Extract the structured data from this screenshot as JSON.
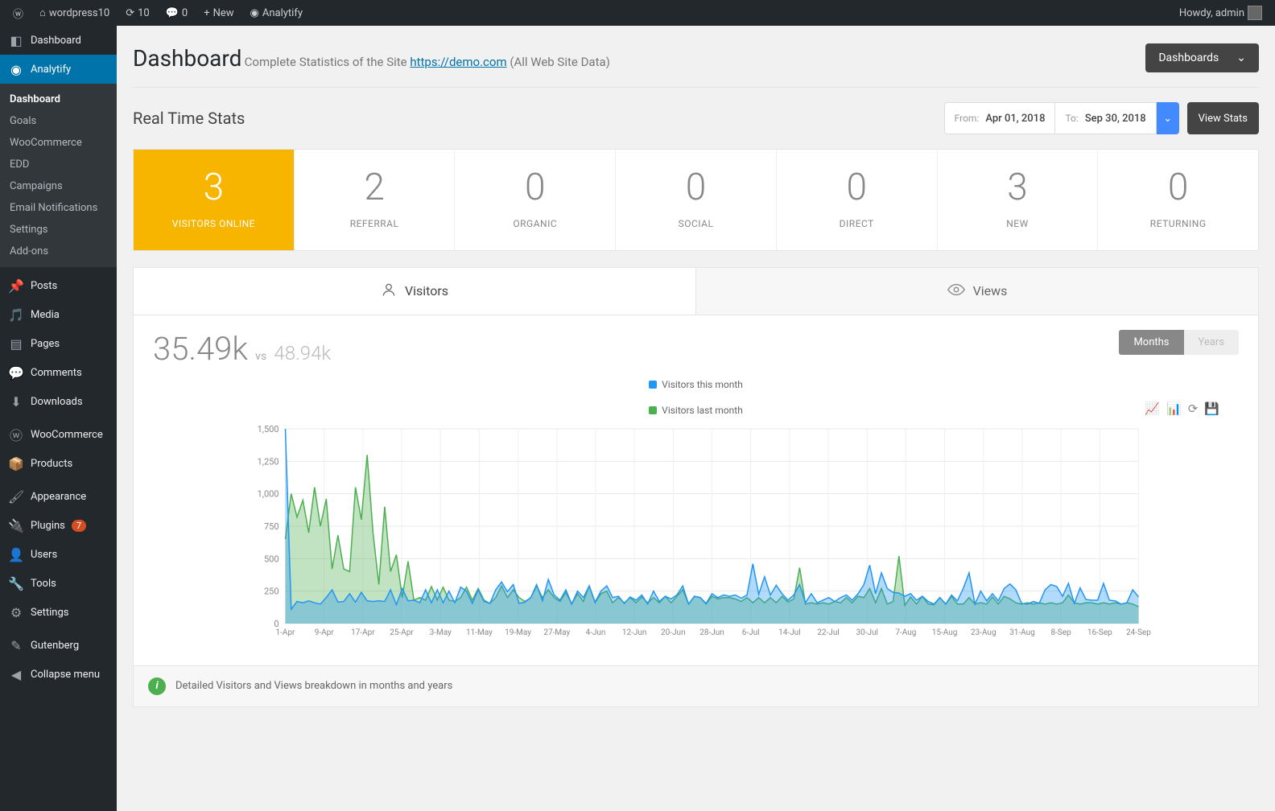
{
  "topbar": {
    "site_name": "wordpress10",
    "update_count": "10",
    "comment_count": "0",
    "new_label": "New",
    "analytify_label": "Analytify",
    "howdy": "Howdy, admin"
  },
  "sidebar": {
    "items": [
      {
        "label": "Dashboard",
        "icon": "dashboard"
      },
      {
        "label": "Analytify",
        "icon": "chart",
        "active": true
      },
      {
        "label": "Posts",
        "icon": "pin"
      },
      {
        "label": "Media",
        "icon": "media"
      },
      {
        "label": "Pages",
        "icon": "pages"
      },
      {
        "label": "Comments",
        "icon": "comment"
      },
      {
        "label": "Downloads",
        "icon": "download"
      },
      {
        "label": "WooCommerce",
        "icon": "woo"
      },
      {
        "label": "Products",
        "icon": "box"
      },
      {
        "label": "Appearance",
        "icon": "brush"
      },
      {
        "label": "Plugins",
        "icon": "plug",
        "badge": "7"
      },
      {
        "label": "Users",
        "icon": "user"
      },
      {
        "label": "Tools",
        "icon": "wrench"
      },
      {
        "label": "Settings",
        "icon": "sliders"
      },
      {
        "label": "Gutenberg",
        "icon": "edit"
      },
      {
        "label": "Collapse menu",
        "icon": "collapse"
      }
    ],
    "sub": [
      "Dashboard",
      "Goals",
      "WooCommerce",
      "EDD",
      "Campaigns",
      "Email Notifications",
      "Settings",
      "Add-ons"
    ]
  },
  "header": {
    "title": "Dashboard",
    "subtitle_pre": "Complete Statistics of the Site ",
    "site_url": "https://demo.com",
    "subtitle_post": " (All Web Site Data)",
    "dashboards_btn": "Dashboards"
  },
  "realtime": {
    "title": "Real Time Stats",
    "from_label": "From:",
    "from": "Apr 01, 2018",
    "to_label": "To:",
    "to": "Sep 30, 2018",
    "view_btn": "View Stats"
  },
  "stats": [
    {
      "num": "3",
      "label": "VISITORS ONLINE",
      "highlight": true
    },
    {
      "num": "2",
      "label": "REFERRAL"
    },
    {
      "num": "0",
      "label": "ORGANIC"
    },
    {
      "num": "0",
      "label": "SOCIAL"
    },
    {
      "num": "0",
      "label": "DIRECT"
    },
    {
      "num": "3",
      "label": "NEW"
    },
    {
      "num": "0",
      "label": "RETURNING"
    }
  ],
  "tabs": {
    "visitors": "Visitors",
    "views": "Views"
  },
  "metric": {
    "main": "35.49k",
    "vs": "vs",
    "sub": "48.94k"
  },
  "toggle": {
    "months": "Months",
    "years": "Years"
  },
  "legend": {
    "this": "Visitors this month",
    "last": "Visitors last month"
  },
  "footer": "Detailed Visitors and Views breakdown in months and years",
  "chart_data": {
    "type": "line",
    "xlabel": "",
    "ylabel": "",
    "ylim": [
      0,
      1500
    ],
    "yticks": [
      0,
      250,
      500,
      750,
      1000,
      1250,
      1500
    ],
    "categories": [
      "1-Apr",
      "9-Apr",
      "17-Apr",
      "25-Apr",
      "3-May",
      "11-May",
      "19-May",
      "27-May",
      "4-Jun",
      "12-Jun",
      "20-Jun",
      "28-Jun",
      "6-Jul",
      "14-Jul",
      "22-Jul",
      "30-Jul",
      "7-Aug",
      "15-Aug",
      "23-Aug",
      "31-Aug",
      "8-Sep",
      "16-Sep",
      "24-Sep"
    ],
    "series": [
      {
        "name": "Visitors last month",
        "color": "#4caf50",
        "values": [
          650,
          1000,
          820,
          950,
          700,
          1050,
          750,
          960,
          420,
          680,
          420,
          400,
          1050,
          800,
          1300,
          700,
          300,
          900,
          400,
          530,
          200,
          480,
          180,
          200,
          180,
          285,
          180,
          280,
          180,
          170,
          200,
          280,
          180,
          270,
          180,
          155,
          200,
          290,
          200,
          260,
          200,
          170,
          200,
          290,
          200,
          260,
          200,
          170,
          240,
          150,
          230,
          170,
          290,
          160,
          230,
          250,
          160,
          200,
          160,
          200,
          160,
          205,
          160,
          200,
          160,
          210,
          160,
          210,
          260,
          150,
          210,
          200,
          150,
          210,
          190,
          200,
          200,
          190,
          170,
          200,
          160,
          200,
          160,
          200,
          160,
          210,
          165,
          190,
          430,
          150,
          160,
          150,
          160,
          150,
          170,
          160,
          200,
          160,
          210,
          200,
          270,
          160,
          270,
          150,
          170,
          520,
          140,
          205,
          150,
          210,
          150,
          145,
          200,
          150,
          210,
          150,
          150,
          200,
          150,
          160,
          150,
          205,
          150,
          210,
          190,
          160,
          150,
          160,
          150,
          160,
          150,
          160,
          150,
          160,
          220,
          160,
          150,
          160,
          160,
          150,
          160,
          150,
          160,
          150,
          160,
          150,
          130
        ]
      },
      {
        "name": "Visitors this month",
        "color": "#2196f3",
        "values": [
          1500,
          110,
          170,
          160,
          175,
          160,
          150,
          200,
          260,
          165,
          170,
          230,
          165,
          240,
          175,
          170,
          175,
          170,
          260,
          145,
          270,
          175,
          180,
          160,
          260,
          160,
          260,
          160,
          250,
          160,
          280,
          250,
          155,
          260,
          170,
          155,
          260,
          320,
          245,
          300,
          155,
          165,
          200,
          300,
          175,
          340,
          220,
          180,
          260,
          150,
          250,
          200,
          290,
          165,
          250,
          290,
          200,
          210,
          155,
          205,
          180,
          220,
          150,
          250,
          170,
          210,
          190,
          220,
          290,
          150,
          210,
          200,
          155,
          230,
          200,
          220,
          210,
          220,
          195,
          220,
          460,
          225,
          360,
          220,
          295,
          230,
          180,
          220,
          300,
          160,
          230,
          160,
          180,
          200,
          170,
          200,
          220,
          180,
          230,
          300,
          450,
          230,
          390,
          270,
          240,
          235,
          210,
          230,
          180,
          210,
          170,
          150,
          200,
          150,
          220,
          175,
          270,
          390,
          150,
          250,
          175,
          230,
          175,
          270,
          305,
          260,
          155,
          150,
          170,
          155,
          260,
          300,
          285,
          210,
          310,
          155,
          275,
          185,
          180,
          180,
          310,
          180,
          175,
          150,
          160,
          260,
          205
        ]
      }
    ]
  }
}
